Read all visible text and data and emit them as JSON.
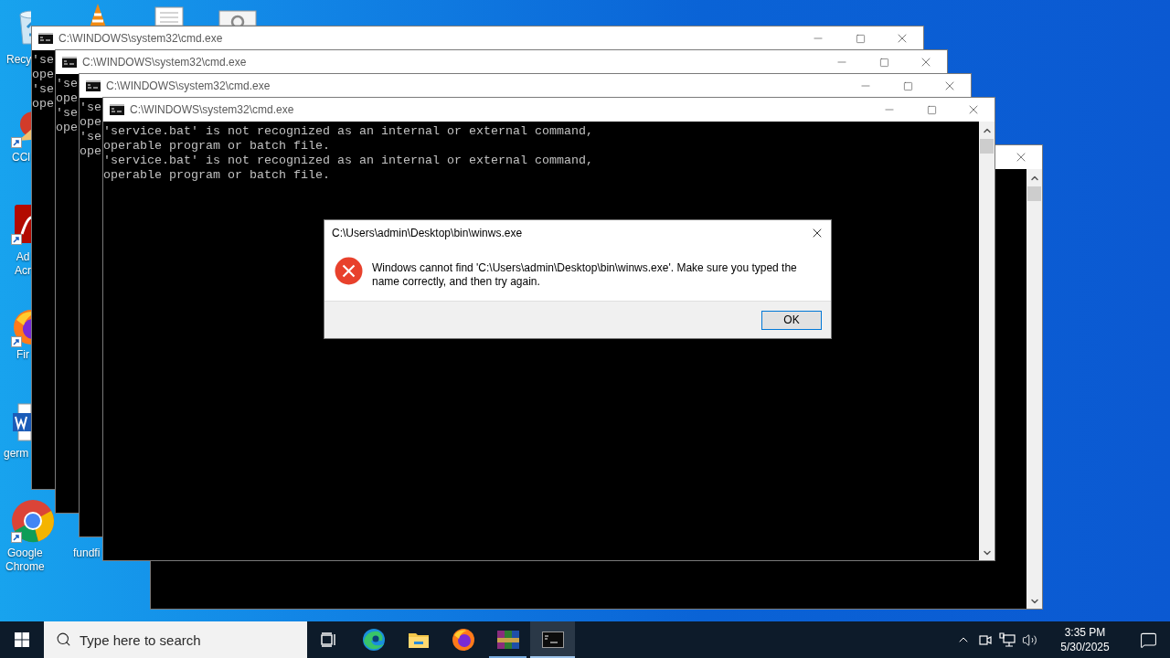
{
  "desktop_icons": [
    {
      "kind": "recycle-bin",
      "label_lines": [
        "Recy"
      ],
      "shortcut": false
    },
    {
      "kind": "cone",
      "shortcut": false
    },
    {
      "kind": "document",
      "shortcut": false
    },
    {
      "kind": "settings-document",
      "shortcut": false
    },
    {
      "kind": "broom",
      "label_lines": [
        "CCl"
      ],
      "shortcut": true
    },
    {
      "kind": "pdf",
      "label_lines": [
        "Ad",
        "Acr"
      ],
      "shortcut": true
    },
    {
      "kind": "fox",
      "label_lines": [
        "Fir"
      ],
      "shortcut": true
    },
    {
      "kind": "word",
      "label_lines": [
        "germ"
      ],
      "shortcut": false
    },
    {
      "kind": "chrome",
      "label_lines": [
        "Google",
        "Chrome"
      ],
      "shortcut": true
    },
    {
      "label_lines": [
        "fundfi"
      ]
    }
  ],
  "windows": [
    {
      "title": "C:\\WINDOWS\\system32\\cmd.exe",
      "controls": [
        {
          "kind": "minimize"
        },
        {
          "kind": "maximize"
        },
        {
          "kind": "close"
        }
      ],
      "lines": [
        "'se",
        "ope",
        "'se",
        "ope"
      ]
    },
    {
      "title": "C:\\WINDOWS\\system32\\cmd.exe",
      "controls": [
        {
          "kind": "minimize"
        },
        {
          "kind": "maximize"
        },
        {
          "kind": "close"
        }
      ],
      "lines": [
        "'se",
        "ope",
        "'se",
        "ope"
      ]
    },
    {
      "title": "C:\\WINDOWS\\system32\\cmd.exe",
      "controls": [
        {
          "kind": "minimize"
        },
        {
          "kind": "maximize"
        },
        {
          "kind": "close"
        }
      ],
      "lines": [
        "'se",
        "ope",
        "'se",
        "ope"
      ]
    },
    {
      "title": "C:\\WINDOWS\\system32\\cmd.exe",
      "controls": [
        {
          "kind": "minimize"
        },
        {
          "kind": "maximize"
        },
        {
          "kind": "close"
        }
      ],
      "lines": [
        "'service.bat' is not recognized as an internal or external command,",
        "operable program or batch file.",
        "'service.bat' is not recognized as an internal or external command,",
        "operable program or batch file."
      ]
    }
  ],
  "background_window": {
    "controls": [
      {
        "kind": "close"
      }
    ]
  },
  "dialog": {
    "title": "C:\\Users\\admin\\Desktop\\bin\\winws.exe",
    "kind": "error",
    "message": "Windows cannot find 'C:\\Users\\admin\\Desktop\\bin\\winws.exe'. Make sure you typed the name correctly, and then try again.",
    "button": "OK"
  },
  "taskbar": {
    "search": {
      "placeholder": "Type here to search"
    },
    "apps": [
      {
        "kind": "edge",
        "running": false,
        "selected": false
      },
      {
        "kind": "folder",
        "running": false,
        "selected": false
      },
      {
        "kind": "fox",
        "running": false,
        "selected": false
      },
      {
        "kind": "archive",
        "running": true,
        "selected": false
      },
      {
        "kind": "terminal",
        "running": true,
        "selected": true
      }
    ],
    "time": "3:35 PM",
    "date": "5/30/2025"
  }
}
